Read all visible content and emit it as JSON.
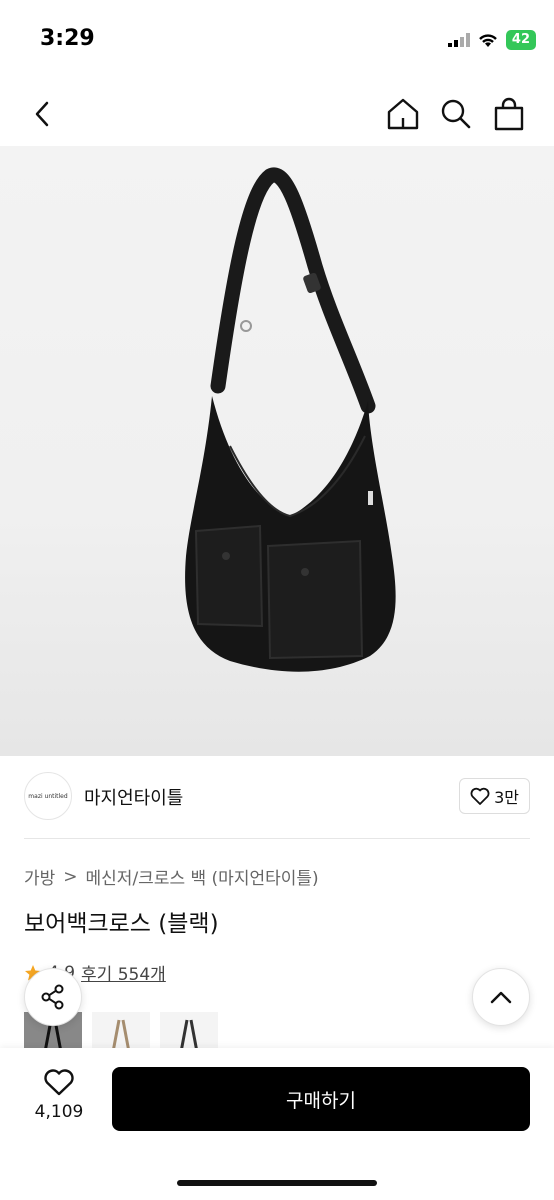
{
  "status": {
    "time": "3:29",
    "battery": "42"
  },
  "nav": {
    "back_icon": "chevron-left-icon",
    "home_icon": "home-icon",
    "search_icon": "search-icon",
    "cart_icon": "shopping-bag-icon"
  },
  "product_image": {
    "alt_icon": "crossbody-bag-image"
  },
  "brand": {
    "logo_text": "mazi untitled",
    "name": "마지언타이틀",
    "likes": "3만"
  },
  "breadcrumb": {
    "level1": "가방",
    "separator": ">",
    "level2": "메신저/크로스 백 (마지언타이틀)"
  },
  "product": {
    "title": "보어백크로스 (블랙)"
  },
  "rating": {
    "score": "4.9",
    "reviews_label": "후기 554개"
  },
  "thumbnails": [
    "black",
    "beige",
    "white"
  ],
  "bottom": {
    "wish_count": "4,109",
    "buy_label": "구매하기"
  },
  "colors": {
    "accent": "#000000",
    "star": "#f5a623"
  }
}
